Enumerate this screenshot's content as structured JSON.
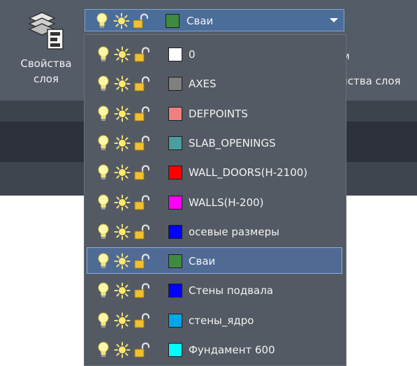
{
  "ribbon": {
    "properties_label_line1": "Свойства",
    "properties_label_line2": "слоя",
    "right_partial_top": "м",
    "right_partial_label": "йства слоя"
  },
  "combo": {
    "current_layer": "Сваи",
    "current_color": "#3e8a3e"
  },
  "layers": [
    {
      "name": "0",
      "color": "#ffffff"
    },
    {
      "name": "AXES",
      "color": "#808080"
    },
    {
      "name": "DEFPOINTS",
      "color": "#f08080"
    },
    {
      "name": "SLAB_OPENINGS",
      "color": "#4a9e9e"
    },
    {
      "name": "WALL_DOORS(H-2100)",
      "color": "#ff0000"
    },
    {
      "name": "WALLS(H-200)",
      "color": "#ff00ff"
    },
    {
      "name": "осевые размеры",
      "color": "#0000ff"
    },
    {
      "name": "Сваи",
      "color": "#3e8a3e"
    },
    {
      "name": "Стены подвала",
      "color": "#0000ff"
    },
    {
      "name": "стены_ядро",
      "color": "#00a8e8"
    },
    {
      "name": "Фундамент 600",
      "color": "#00ffff"
    }
  ],
  "selected_index": 7
}
